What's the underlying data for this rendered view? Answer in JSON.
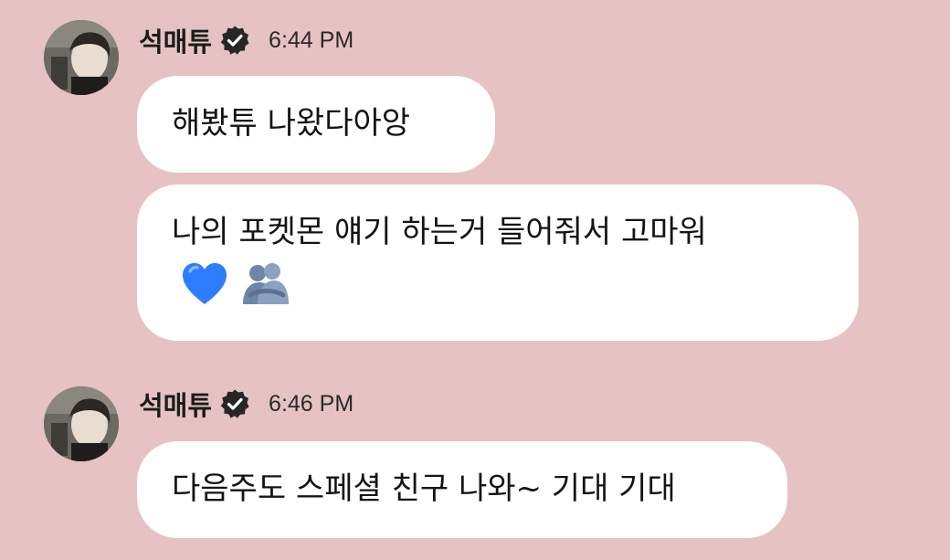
{
  "messages": [
    {
      "sender": "석매튜",
      "time": "6:44 PM",
      "avatar_icon": "avatar-photo",
      "verified_icon": "verified-badge-icon",
      "bubbles": [
        {
          "text": "해봤튜 나왔다아앙"
        },
        {
          "text": "나의 포켓몬 얘기 하는거 들어줘서 고마워",
          "emojis": [
            "blue-heart-icon",
            "hugging-people-icon"
          ]
        }
      ]
    },
    {
      "sender": "석매튜",
      "time": "6:46 PM",
      "avatar_icon": "avatar-photo",
      "verified_icon": "verified-badge-icon",
      "bubbles": [
        {
          "text": "다음주도 스페셜 친구 나와~ 기대 기대"
        }
      ]
    }
  ],
  "colors": {
    "background": "#e6c2c2",
    "bubble": "#ffffff",
    "text": "#1b1b1b",
    "heart": "#2f7dff",
    "hug": "#7f99b8"
  }
}
